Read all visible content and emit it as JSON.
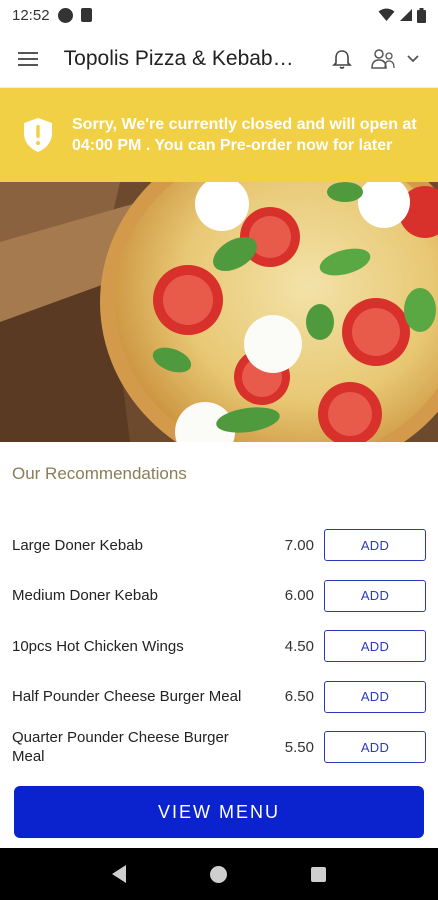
{
  "status_bar": {
    "time": "12:52"
  },
  "app_bar": {
    "title": "Topolis Pizza & Kebab Ho"
  },
  "notice": {
    "message": "Sorry, We're currently closed and will open at 04:00 PM . You can Pre-order now for later"
  },
  "recommendations": {
    "title": "Our Recommendations",
    "items": [
      {
        "name": "Large Doner Kebab",
        "price": "7.00",
        "button": "ADD"
      },
      {
        "name": "Medium Doner Kebab",
        "price": "6.00",
        "button": "ADD"
      },
      {
        "name": "10pcs Hot Chicken Wings",
        "price": "4.50",
        "button": "ADD"
      },
      {
        "name": "Half Pounder Cheese Burger Meal",
        "price": "6.50",
        "button": "ADD"
      },
      {
        "name": "Quarter Pounder Cheese Burger Meal",
        "price": "5.50",
        "button": "ADD"
      }
    ]
  },
  "footer": {
    "view_menu_label": "VIEW MENU"
  },
  "colors": {
    "notice_bg": "#f2d045",
    "accent": "#0a23cf",
    "section_title": "#8a7d58"
  },
  "icons": [
    "menu-icon",
    "bell-icon",
    "user-icon",
    "chevron-down-icon",
    "shield-alert-icon"
  ]
}
